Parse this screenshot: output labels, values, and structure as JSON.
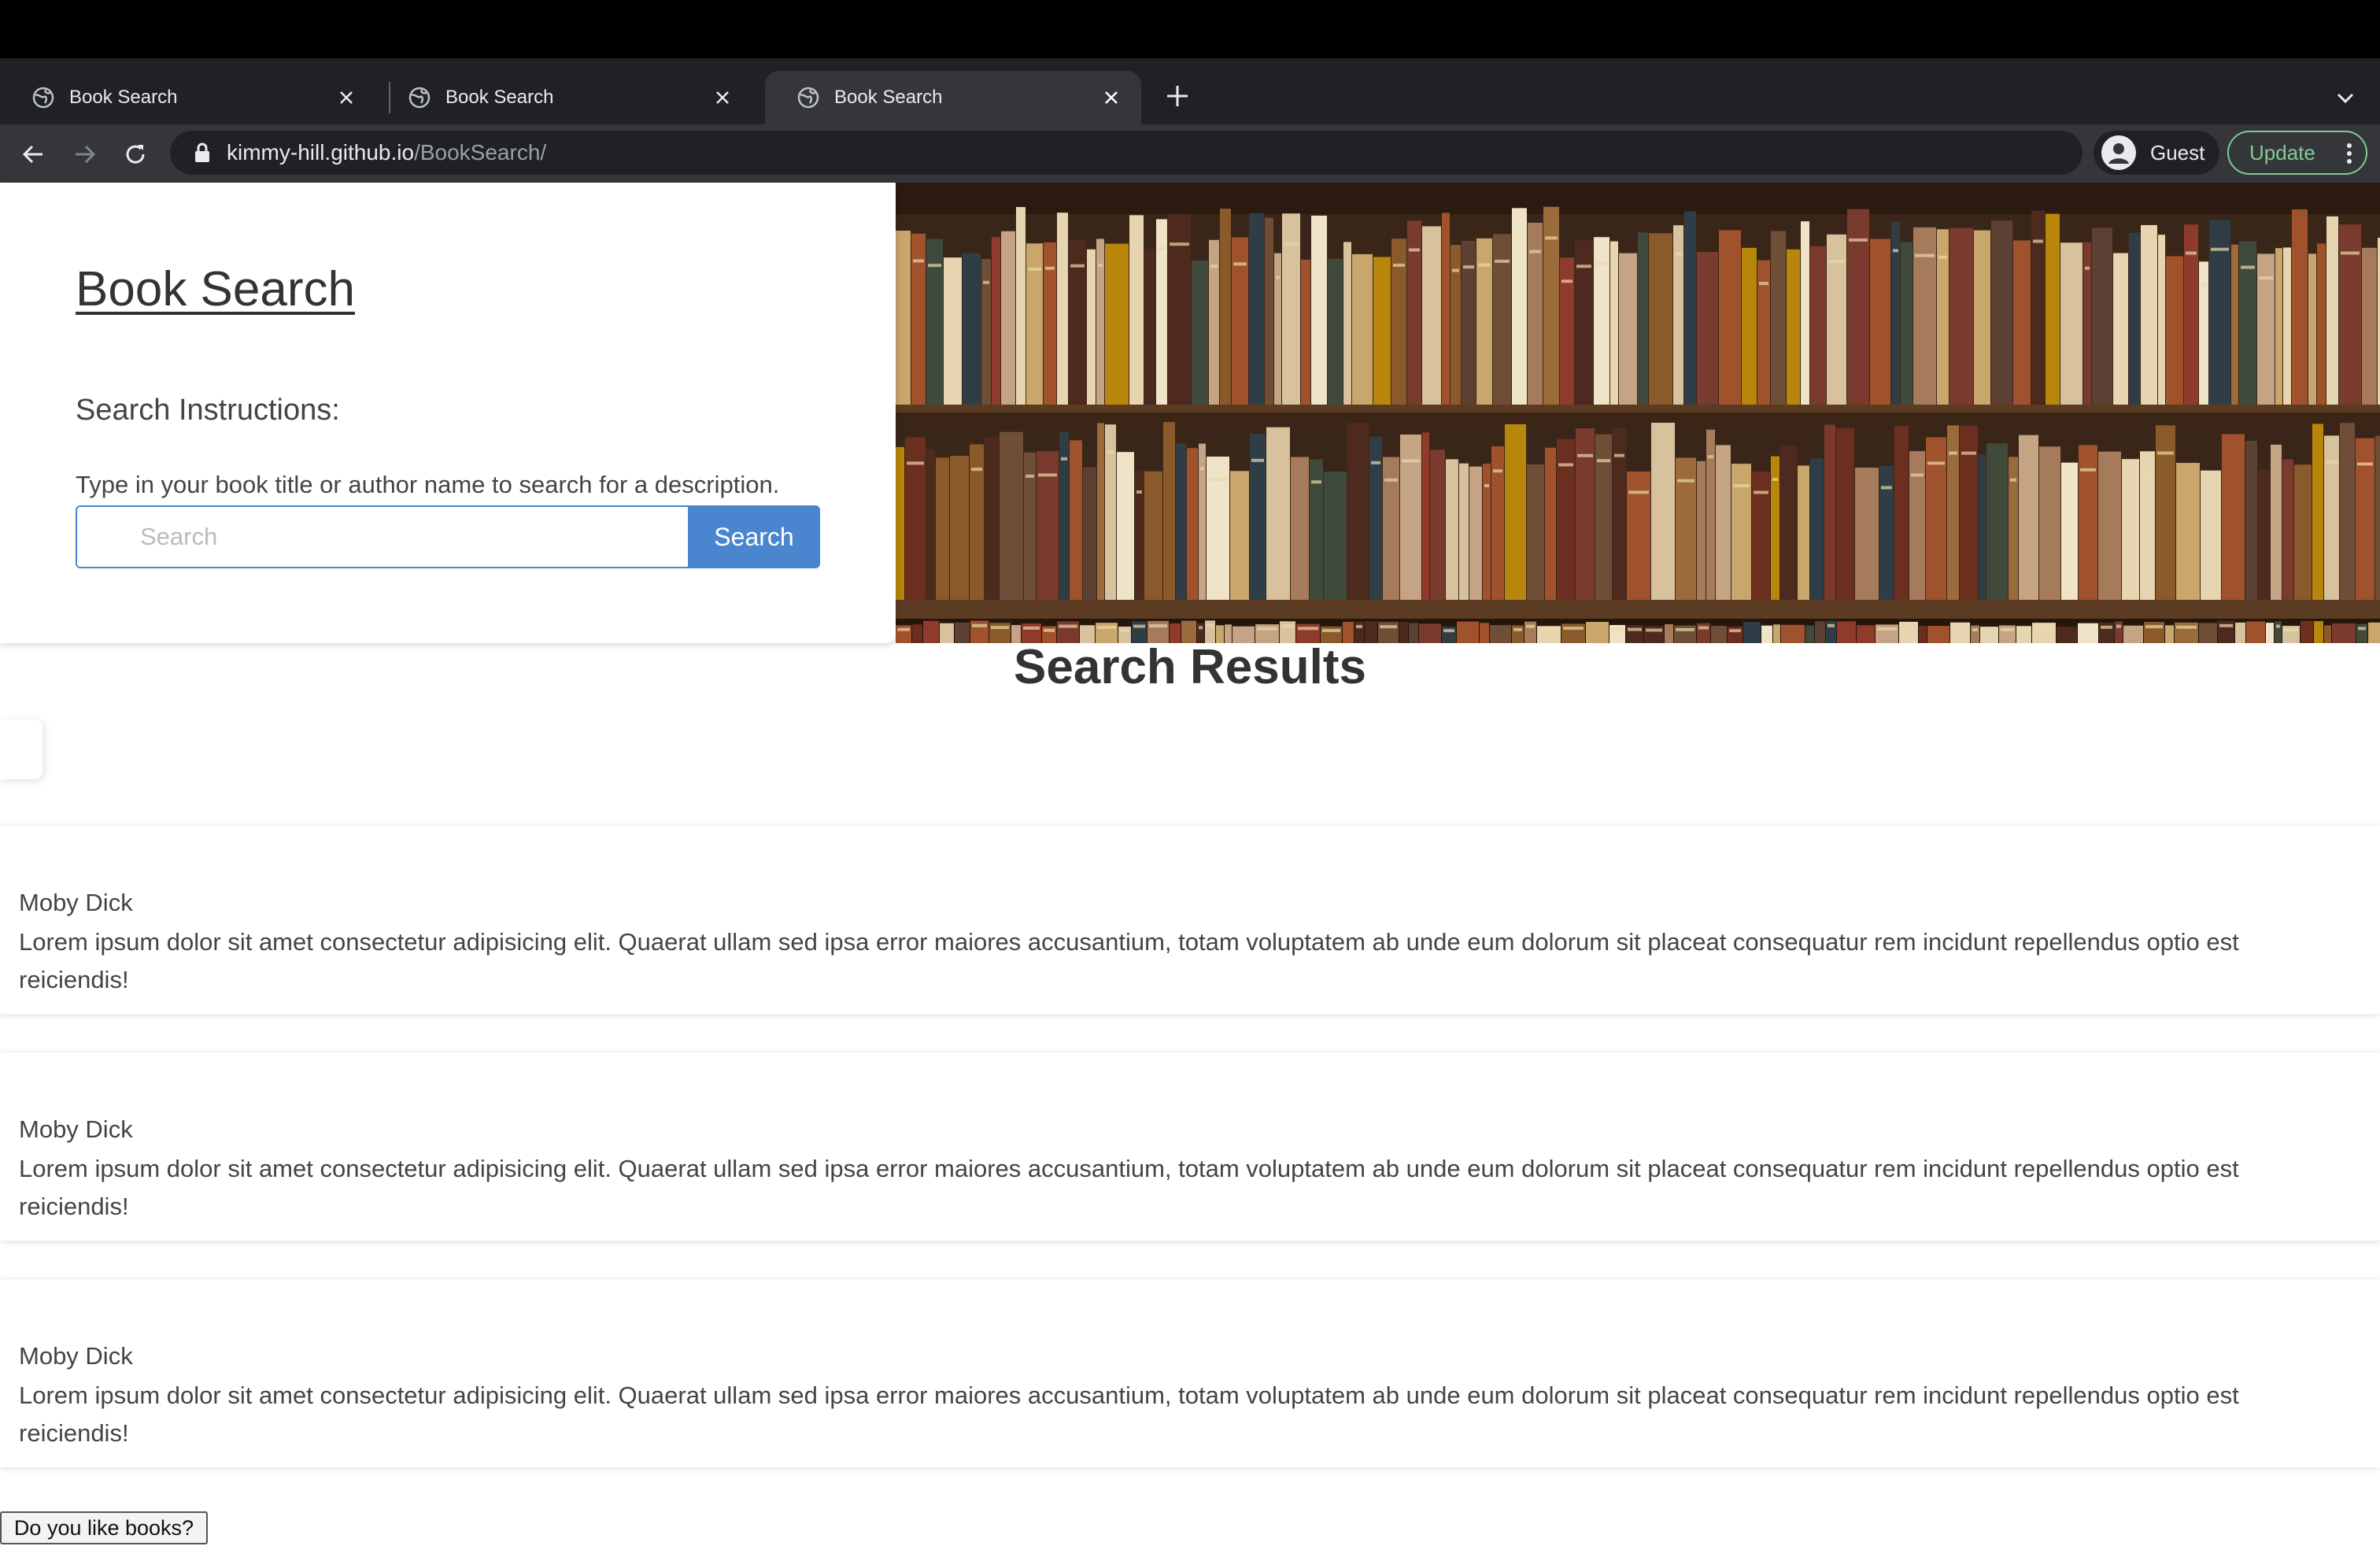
{
  "browser": {
    "tabs": [
      {
        "title": "Book Search"
      },
      {
        "title": "Book Search"
      },
      {
        "title": "Book Search"
      }
    ],
    "active_tab": 2,
    "url_host": "kimmy-hill.github.io",
    "url_path": "/BookSearch/",
    "profile_label": "Guest",
    "update_label": "Update"
  },
  "hero": {
    "title": "Book Search",
    "instructions_title": "Search Instructions:",
    "instructions_text": "Type in your book title or author name to search for a description.",
    "search_placeholder": "Search",
    "search_button": "Search"
  },
  "results": {
    "title": "Search Results",
    "items": [
      {
        "title": "Moby Dick",
        "description": "Lorem ipsum dolor sit amet consectetur adipisicing elit. Quaerat ullam sed ipsa error maiores accusantium, totam voluptatem ab unde eum dolorum sit placeat consequatur rem incidunt repellendus optio est reiciendis!"
      },
      {
        "title": "Moby Dick",
        "description": "Lorem ipsum dolor sit amet consectetur adipisicing elit. Quaerat ullam sed ipsa error maiores accusantium, totam voluptatem ab unde eum dolorum sit placeat consequatur rem incidunt repellendus optio est reiciendis!"
      },
      {
        "title": "Moby Dick",
        "description": "Lorem ipsum dolor sit amet consectetur adipisicing elit. Quaerat ullam sed ipsa error maiores accusantium, totam voluptatem ab unde eum dolorum sit placeat consequatur rem incidunt repellendus optio est reiciendis!"
      }
    ]
  },
  "footer_button": "Do you like books?",
  "colors": {
    "accent": "#4a86cf",
    "update_green": "#81c995",
    "chrome_dark": "#202124",
    "chrome_mid": "#35363a"
  }
}
